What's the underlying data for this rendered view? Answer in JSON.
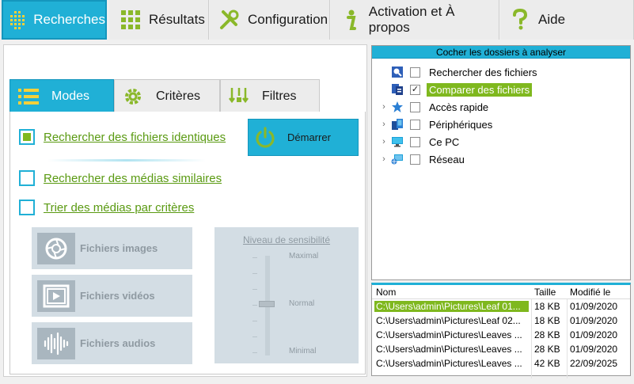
{
  "top_tabs": [
    {
      "label": "Recherches",
      "icon": "grid-dots-icon",
      "active": true
    },
    {
      "label": "Résultats",
      "icon": "grid-squares-icon",
      "active": false
    },
    {
      "label": "Configuration",
      "icon": "wrench-screwdriver-icon",
      "active": false
    },
    {
      "label": "Activation et À propos",
      "icon": "info-icon",
      "active": false
    },
    {
      "label": "Aide",
      "icon": "question-icon",
      "active": false
    }
  ],
  "sub_tabs": [
    {
      "label": "Modes",
      "icon": "list-icon",
      "active": true
    },
    {
      "label": "Critères",
      "icon": "gear-icon",
      "active": false
    },
    {
      "label": "Filtres",
      "icon": "filter-icon",
      "active": false
    }
  ],
  "modes": [
    {
      "label": "Rechercher des fichiers identiques",
      "checked": true
    },
    {
      "label": "Rechercher des médias similaires",
      "checked": false
    },
    {
      "label": "Trier des médias par critères",
      "checked": false
    }
  ],
  "start_button": {
    "label": "Démarrer"
  },
  "media_types": [
    {
      "label": "Fichiers images"
    },
    {
      "label": "Fichiers vidéos"
    },
    {
      "label": "Fichiers audios"
    }
  ],
  "sensitivity": {
    "title": "Niveau de sensibilité",
    "levels": [
      "Maximal",
      "Normal",
      "Minimal"
    ],
    "value": "Normal"
  },
  "tree": {
    "header": "Cocher les dossiers à analyser",
    "nodes": [
      {
        "label": "Rechercher des fichiers",
        "expandable": false,
        "checked": false,
        "selected": false,
        "icon": "search-folder-icon"
      },
      {
        "label": "Comparer des fichiers",
        "expandable": false,
        "checked": true,
        "selected": true,
        "icon": "compare-folder-icon"
      },
      {
        "label": "Accès rapide",
        "expandable": true,
        "checked": false,
        "selected": false,
        "icon": "star-icon"
      },
      {
        "label": "Périphériques",
        "expandable": true,
        "checked": false,
        "selected": false,
        "icon": "devices-icon"
      },
      {
        "label": "Ce PC",
        "expandable": true,
        "checked": false,
        "selected": false,
        "icon": "monitor-icon"
      },
      {
        "label": "Réseau",
        "expandable": true,
        "checked": false,
        "selected": false,
        "icon": "network-icon"
      }
    ]
  },
  "files": {
    "columns": [
      "Nom",
      "Taille",
      "Modifié le"
    ],
    "rows": [
      {
        "name": "C:\\Users\\admin\\Pictures\\Leaf 01...",
        "size": "18 KB",
        "modified": "01/09/2020",
        "selected": true
      },
      {
        "name": "C:\\Users\\admin\\Pictures\\Leaf 02...",
        "size": "18 KB",
        "modified": "01/09/2020",
        "selected": false
      },
      {
        "name": "C:\\Users\\admin\\Pictures\\Leaves ...",
        "size": "28 KB",
        "modified": "01/09/2020",
        "selected": false
      },
      {
        "name": "C:\\Users\\admin\\Pictures\\Leaves ...",
        "size": "28 KB",
        "modified": "01/09/2020",
        "selected": false
      },
      {
        "name": "C:\\Users\\admin\\Pictures\\Leaves ...",
        "size": "42 KB",
        "modified": "22/09/2025",
        "selected": false
      }
    ]
  },
  "colors": {
    "accent": "#20b0d6",
    "green": "#7fb81e",
    "link": "#5a9a12"
  }
}
